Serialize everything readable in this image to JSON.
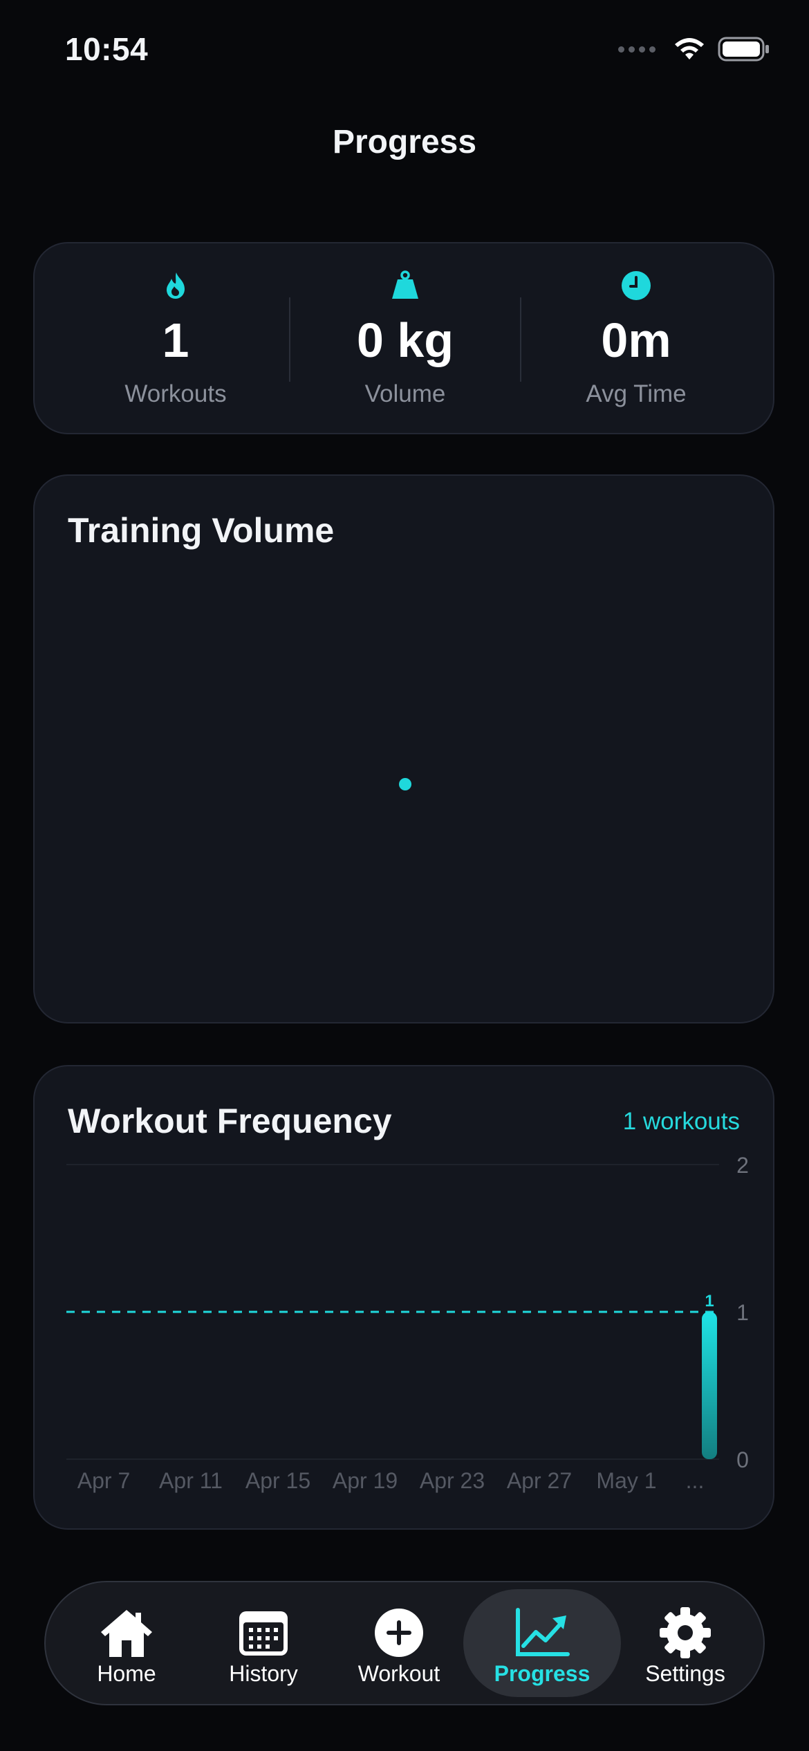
{
  "status_bar": {
    "time": "10:54",
    "icons": [
      "cellular-signal-icon",
      "wifi-icon",
      "battery-icon"
    ]
  },
  "page": {
    "title": "Progress"
  },
  "stats": [
    {
      "icon": "flame-icon",
      "value": "1",
      "label": "Workouts"
    },
    {
      "icon": "weight-icon",
      "value": "0 kg",
      "label": "Volume"
    },
    {
      "icon": "clock-icon",
      "value": "0m",
      "label": "Avg Time"
    }
  ],
  "training_volume": {
    "title": "Training Volume"
  },
  "workout_frequency": {
    "title": "Workout Frequency",
    "badge": "1 workouts"
  },
  "chart_data": [
    {
      "type": "scatter",
      "title": "Training Volume",
      "series": [
        {
          "x": [
            0
          ],
          "y": [
            0
          ]
        }
      ]
    },
    {
      "type": "bar",
      "title": "Workout Frequency",
      "categories": [
        "Apr 7",
        "Apr 11",
        "Apr 15",
        "Apr 19",
        "Apr 23",
        "Apr 27",
        "May 1",
        "..."
      ],
      "values": [
        0,
        0,
        0,
        0,
        0,
        0,
        0,
        1
      ],
      "ylim": [
        0,
        2
      ],
      "yticks": [
        "2",
        "1",
        "0"
      ],
      "average_line": 1,
      "bar_labels": [
        "1"
      ],
      "colors": {
        "bar": "#1fd8dc",
        "average_line": "#1fd8dc"
      }
    }
  ],
  "nav": {
    "items": [
      {
        "label": "Home",
        "icon": "house-icon",
        "active": false
      },
      {
        "label": "History",
        "icon": "calendar-icon",
        "active": false
      },
      {
        "label": "Workout",
        "icon": "plus-circle-icon",
        "active": false
      },
      {
        "label": "Progress",
        "icon": "chart-trend-icon",
        "active": true
      },
      {
        "label": "Settings",
        "icon": "gear-icon",
        "active": false
      }
    ]
  },
  "colors": {
    "accent": "#1fd8dc",
    "background": "#07080b",
    "card": "#13161e"
  }
}
